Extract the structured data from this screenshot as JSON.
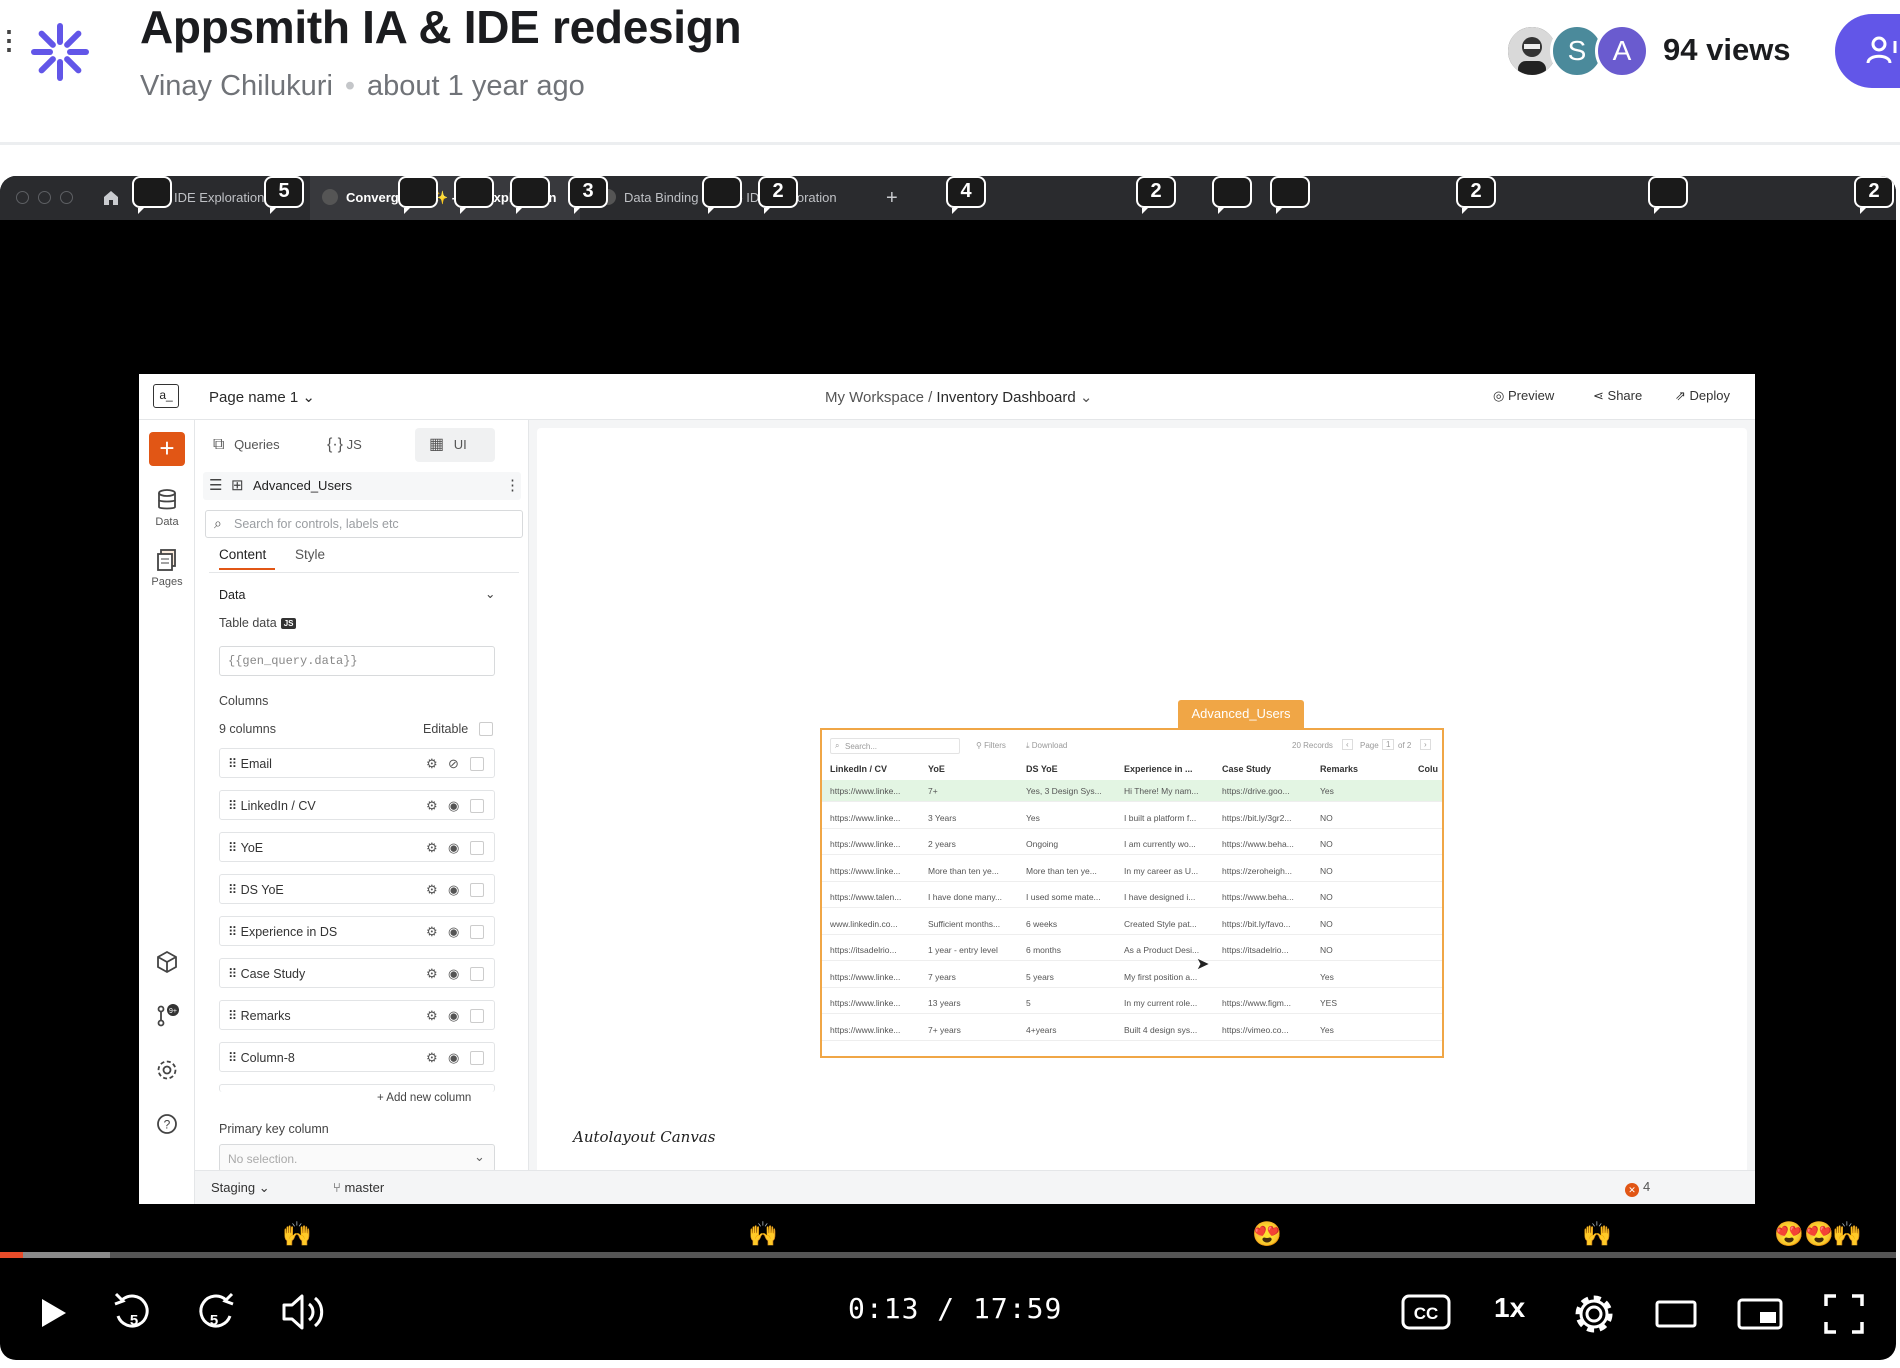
{
  "header": {
    "title": "Appsmith IA & IDE redesign",
    "author": "Vinay Chilukuri",
    "time_ago": "about 1 year ago",
    "viewers": [
      "S",
      "A"
    ],
    "views": "94 views",
    "logo_color": "#6256e8"
  },
  "browser": {
    "tabs": [
      {
        "label": "IDE Exploration",
        "active": false
      },
      {
        "label": "Convergence ✨ - IDE Exploration",
        "active": true
      },
      {
        "label": "Data Binding 🔗⛓ - IDE Exploration",
        "active": false
      }
    ],
    "close_glyph": "✕",
    "new_tab_glyph": "+",
    "more_glyph": "···"
  },
  "app": {
    "logo": "a_",
    "page_name": "Page name 1",
    "workspace": "My Workspace /",
    "dashboard": "Inventory Dashboard",
    "preview": "Preview",
    "share": "Share",
    "deploy": "Deploy",
    "rail": {
      "data": "Data",
      "pages": "Pages",
      "git_badge": "9+"
    },
    "panel_tabs": {
      "queries": "Queries",
      "js": "JS",
      "ui": "UI"
    },
    "widget_name": "Advanced_Users",
    "search_placeholder": "Search for controls, labels etc",
    "content_tabs": {
      "content": "Content",
      "style": "Style"
    },
    "section_data": "Data",
    "table_data_label": "Table data",
    "js_badge": "JS",
    "table_data_value": "{{gen_query.data}}",
    "columns_label": "Columns",
    "columns_count": "9 columns",
    "editable_label": "Editable",
    "columns": [
      "Email",
      "LinkedIn / CV",
      "YoE",
      "DS YoE",
      "Experience in DS",
      "Case Study",
      "Remarks",
      "Column-8"
    ],
    "add_column": "+ Add new column",
    "primary_key_label": "Primary key column",
    "primary_key_placeholder": "No selection.",
    "canvas_label": "Autolayout Canvas",
    "widget_tag": "Advanced_Users",
    "table": {
      "search_placeholder": "Search...",
      "filters": "Filters",
      "download": "Download",
      "records": "20 Records",
      "page_label": "Page",
      "page_num": "1",
      "page_of": "of 2",
      "headers": [
        "LinkedIn / CV",
        "YoE",
        "DS YoE",
        "Experience in ...",
        "Case Study",
        "Remarks",
        "Colu"
      ],
      "rows": [
        [
          "https://www.linke...",
          "7+",
          "Yes, 3 Design Sys...",
          "Hi There! My nam...",
          "https://drive.goo...",
          "Yes"
        ],
        [
          "https://www.linke...",
          "3 Years",
          "Yes",
          "I built a platform f...",
          "https://bit.ly/3gr2...",
          "NO"
        ],
        [
          "https://www.linke...",
          "2 years",
          "Ongoing",
          "I am currently wo...",
          "https://www.beha...",
          "NO"
        ],
        [
          "https://www.linke...",
          "More than ten ye...",
          "More than ten ye...",
          "In my career as U...",
          "https://zeroheigh...",
          "NO"
        ],
        [
          "https://www.talen...",
          "I have done many...",
          "I used some mate...",
          "I have designed i...",
          "https://www.beha...",
          "NO"
        ],
        [
          "www.linkedin.co...",
          "Sufficient months...",
          "6 weeks",
          "Created Style pat...",
          "https://bit.ly/favo...",
          "NO"
        ],
        [
          "https://itsadelrio...",
          "1 year - entry level",
          "6 months",
          "As a Product Desi...",
          "https://itsadelrio...",
          "NO"
        ],
        [
          "https://www.linke...",
          "7 years",
          "5 years",
          "My first position a...",
          "",
          "Yes"
        ],
        [
          "https://www.linke...",
          "13 years",
          "5",
          "In my current role...",
          "https://www.figm...",
          "YES"
        ],
        [
          "https://www.linke...",
          "7+ years",
          "4+years",
          "Built 4 design sys...",
          "https://vimeo.co...",
          "Yes"
        ]
      ]
    },
    "env": "Staging",
    "branch": "master",
    "error_count": "4"
  },
  "comments": {
    "counts": [
      "5",
      "3",
      "2",
      "4",
      "2",
      "2",
      "2"
    ],
    "emoji_reaction": "🙌",
    "emoji_love": "😍"
  },
  "player": {
    "progress": 0.012,
    "buffered": 0.058,
    "current_time": "0:13",
    "separator": "/",
    "duration": "17:59",
    "speed": "1x",
    "accent": "#e84c2a"
  }
}
